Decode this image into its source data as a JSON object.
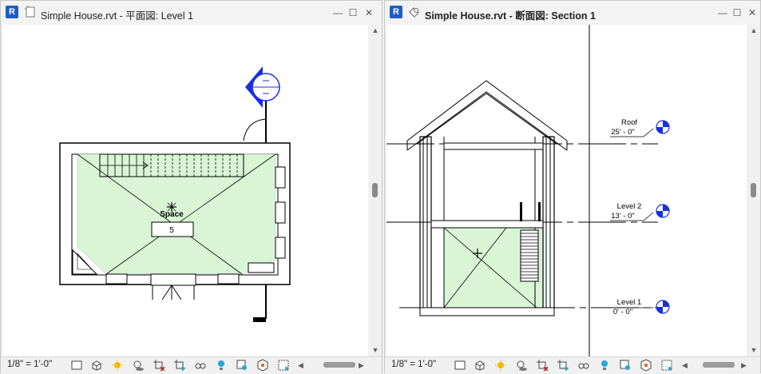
{
  "app": {
    "badge": "R"
  },
  "left_window": {
    "title": "Simple House.rvt - 平面図: Level 1",
    "scale": "1/8\" = 1'-0\"",
    "space": {
      "name": "Space",
      "number": "5"
    },
    "icons": [
      "floor-plan-view-icon"
    ]
  },
  "right_window": {
    "title": "Simple House.rvt - 断面図: Section 1",
    "scale": "1/8\" = 1'-0\"",
    "levels": [
      {
        "name": "Roof",
        "elevation": "25' - 0\""
      },
      {
        "name": "Level 2",
        "elevation": "13' - 0\""
      },
      {
        "name": "Level 1",
        "elevation": "0' - 0\""
      }
    ],
    "icons": [
      "section-view-icon"
    ]
  },
  "window_buttons": {
    "minimize": "—",
    "maximize": "☐",
    "close": "✕"
  },
  "view_controls": [
    "detail-level-icon",
    "visual-style-icon",
    "sun-path-icon",
    "shadows-icon",
    "crop-view-icon",
    "show-crop-icon",
    "temporary-hide-icon",
    "reveal-hidden-icon",
    "lock-3d-icon",
    "analysis-icon",
    "highlight-displacement-icon",
    "worksharing-icon"
  ],
  "colors": {
    "space_fill": "#d9f5d6",
    "app_badge": "#1e5cc8",
    "level_head": "#1a2fe0"
  }
}
